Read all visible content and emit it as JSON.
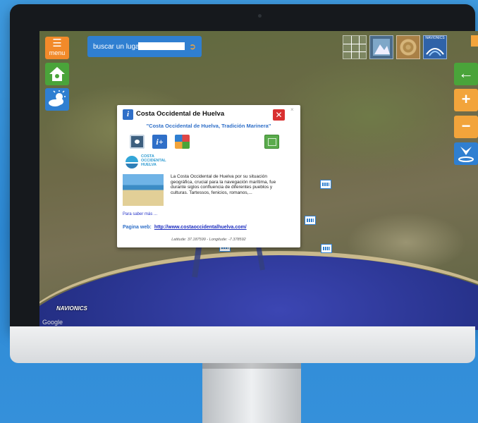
{
  "toolbar": {
    "menu_label": "menu",
    "search_label": "buscar un lugar",
    "search_value": "",
    "search_go": "➲"
  },
  "layers": {
    "navionics_label": "NAVIONICS"
  },
  "right_controls": {
    "back": "←",
    "zoom_in": "+",
    "zoom_out": "−"
  },
  "map": {
    "navionics_logo": "NAVIONICS",
    "google_label": "Google"
  },
  "popup": {
    "close_x": "×",
    "close_button": "✕",
    "info_icon": "i",
    "title": "Costa Occidental de Huelva",
    "subtitle": "\"Costa Occidental de Huelva, Tradición Marinera\"",
    "info_plus": "i+",
    "brand_name": "COSTA\nOCCIDENTAL\nHUELVA",
    "description": "La Costa Occidental de Huelva por su situación geográfica, crucial para la navegación marítima, fue durante siglos confluencia de diferentes pueblos y culturas. Tartessos, fenicios, romanos,...",
    "more_link": "Para saber más ...",
    "web_label": "Pagina web:",
    "web_url": "http://www.costaoccidentalhuelva.com/",
    "coords": "Latitude: 37.187599 - Longitude: -7.378592"
  },
  "colors": {
    "accent_orange": "#f28a2a",
    "accent_green": "#4aa43a",
    "accent_blue": "#2f7fd1"
  }
}
